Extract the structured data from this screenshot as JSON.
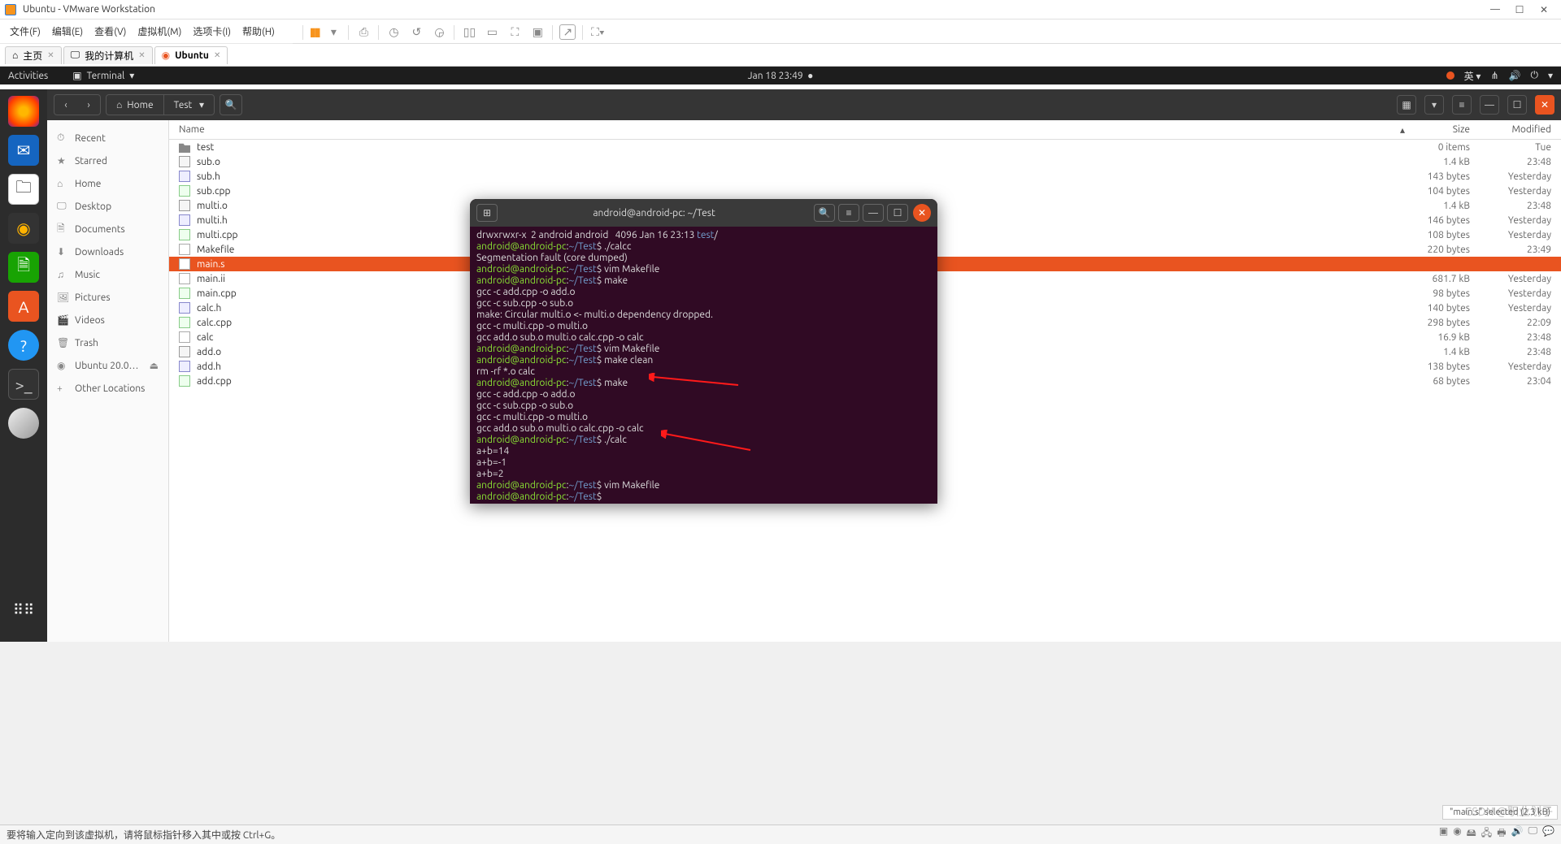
{
  "vmware": {
    "title": "Ubuntu - VMware Workstation",
    "menu": [
      "文件(F)",
      "编辑(E)",
      "查看(V)",
      "虚拟机(M)",
      "选项卡(I)",
      "帮助(H)"
    ],
    "tabs": [
      {
        "label": "主页",
        "icon": "home"
      },
      {
        "label": "我的计算机",
        "icon": "pc"
      },
      {
        "label": "Ubuntu",
        "icon": "ubuntu",
        "active": true
      }
    ]
  },
  "ubuntu_topbar": {
    "activities": "Activities",
    "app": "Terminal",
    "datetime": "Jan 18  23:49",
    "lang": "英"
  },
  "nautilus": {
    "path": [
      "Home",
      "Test"
    ],
    "sidebar": [
      {
        "icon": "⏱",
        "label": "Recent"
      },
      {
        "icon": "★",
        "label": "Starred"
      },
      {
        "icon": "⌂",
        "label": "Home"
      },
      {
        "icon": "🖵",
        "label": "Desktop"
      },
      {
        "icon": "🗎",
        "label": "Documents"
      },
      {
        "icon": "⬇",
        "label": "Downloads"
      },
      {
        "icon": "♫",
        "label": "Music"
      },
      {
        "icon": "🖼",
        "label": "Pictures"
      },
      {
        "icon": "🎬",
        "label": "Videos"
      },
      {
        "icon": "🗑",
        "label": "Trash"
      },
      {
        "icon": "◉",
        "label": "Ubuntu 20.0…"
      },
      {
        "icon": "+",
        "label": "Other Locations"
      }
    ],
    "columns": {
      "name": "Name",
      "size": "Size",
      "modified": "Modified"
    },
    "files": [
      {
        "name": "test",
        "size": "0 items",
        "mod": "Tue",
        "type": "folder"
      },
      {
        "name": "sub.o",
        "size": "1.4 kB",
        "mod": "23:48",
        "type": "o"
      },
      {
        "name": "sub.h",
        "size": "143 bytes",
        "mod": "Yesterday",
        "type": "h"
      },
      {
        "name": "sub.cpp",
        "size": "104 bytes",
        "mod": "Yesterday",
        "type": "cpp"
      },
      {
        "name": "multi.o",
        "size": "1.4 kB",
        "mod": "23:48",
        "type": "o"
      },
      {
        "name": "multi.h",
        "size": "146 bytes",
        "mod": "Yesterday",
        "type": "h"
      },
      {
        "name": "multi.cpp",
        "size": "108 bytes",
        "mod": "Yesterday",
        "type": "cpp"
      },
      {
        "name": "Makefile",
        "size": "220 bytes",
        "mod": "23:49",
        "type": "file"
      },
      {
        "name": "main.s",
        "size": "",
        "mod": "",
        "type": "file",
        "selected": true
      },
      {
        "name": "main.ii",
        "size": "681.7 kB",
        "mod": "Yesterday",
        "type": "file"
      },
      {
        "name": "main.cpp",
        "size": "98 bytes",
        "mod": "Yesterday",
        "type": "cpp"
      },
      {
        "name": "calc.h",
        "size": "140 bytes",
        "mod": "Yesterday",
        "type": "h"
      },
      {
        "name": "calc.cpp",
        "size": "298 bytes",
        "mod": "22:09",
        "type": "cpp"
      },
      {
        "name": "calc",
        "size": "16.9 kB",
        "mod": "23:48",
        "type": "file"
      },
      {
        "name": "add.o",
        "size": "1.4 kB",
        "mod": "23:48",
        "type": "o"
      },
      {
        "name": "add.h",
        "size": "138 bytes",
        "mod": "Yesterday",
        "type": "h"
      },
      {
        "name": "add.cpp",
        "size": "68 bytes",
        "mod": "23:04",
        "type": "cpp"
      }
    ],
    "status": "\"main.s\" selected  (2.3 kB)"
  },
  "terminal": {
    "title": "android@android-pc: ~/Test",
    "lines": [
      {
        "t": "plain",
        "text": "drwxrwxr-x  2 android android   4096 Jan 16 23:13 ",
        "suffix_blue": "test",
        "suffix2": "/"
      },
      {
        "t": "prompt",
        "cmd": "./calcc"
      },
      {
        "t": "plain",
        "text": "Segmentation fault (core dumped)"
      },
      {
        "t": "prompt",
        "cmd": "vim Makefile"
      },
      {
        "t": "prompt",
        "cmd": "make"
      },
      {
        "t": "plain",
        "text": "gcc -c add.cpp -o add.o"
      },
      {
        "t": "plain",
        "text": "gcc -c sub.cpp -o sub.o"
      },
      {
        "t": "plain",
        "text": "make: Circular multi.o <- multi.o dependency dropped."
      },
      {
        "t": "plain",
        "text": "gcc -c multi.cpp -o multi.o"
      },
      {
        "t": "plain",
        "text": "gcc add.o sub.o multi.o calc.cpp -o calc"
      },
      {
        "t": "prompt",
        "cmd": "vim Makefile"
      },
      {
        "t": "prompt",
        "cmd": "make clean"
      },
      {
        "t": "plain",
        "text": "rm -rf *.o calc"
      },
      {
        "t": "prompt",
        "cmd": "make"
      },
      {
        "t": "plain",
        "text": "gcc -c add.cpp -o add.o"
      },
      {
        "t": "plain",
        "text": "gcc -c sub.cpp -o sub.o"
      },
      {
        "t": "plain",
        "text": "gcc -c multi.cpp -o multi.o"
      },
      {
        "t": "plain",
        "text": "gcc add.o sub.o multi.o calc.cpp -o calc"
      },
      {
        "t": "prompt",
        "cmd": "./calc"
      },
      {
        "t": "plain",
        "text": "a+b=14"
      },
      {
        "t": "plain",
        "text": "a+b=-1"
      },
      {
        "t": "plain",
        "text": "a+b=2"
      },
      {
        "t": "prompt",
        "cmd": "vim Makefile"
      },
      {
        "t": "prompt",
        "cmd": ""
      }
    ],
    "prompt_user": "android@android-pc",
    "prompt_path": "~/Test"
  },
  "bottom_hint": "要将输入定向到该虚拟机，请将鼠标指针移入其中或按 Ctrl+G。",
  "watermark": "CSDN @职业划子"
}
